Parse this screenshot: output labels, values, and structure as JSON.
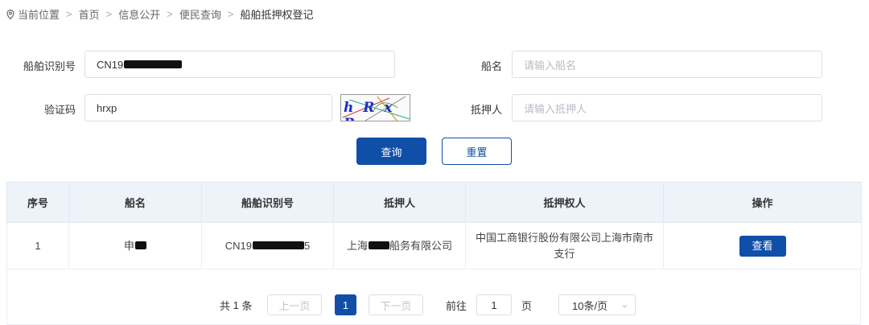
{
  "breadcrumb": {
    "items": [
      "当前位置",
      "首页",
      "信息公开",
      "便民查询",
      "船舶抵押权登记"
    ]
  },
  "form": {
    "ship_id_label": "船舶识别号",
    "ship_id_value": "CN19",
    "ship_name_label": "船名",
    "ship_name_placeholder": "请输入船名",
    "captcha_label": "验证码",
    "captcha_value": "hrxp",
    "captcha_image_text": "h R x P",
    "mortgagor_label": "抵押人",
    "mortgagor_placeholder": "请输入抵押人",
    "search_button": "查询",
    "reset_button": "重置"
  },
  "table": {
    "headers": [
      "序号",
      "船名",
      "船舶识别号",
      "抵押人",
      "抵押权人",
      "操作"
    ],
    "rows": [
      {
        "index": "1",
        "ship_name_prefix": "申",
        "ship_id_prefix": "CN19",
        "ship_id_suffix": "5",
        "mortgagor_prefix": "上海",
        "mortgagor_suffix": "船务有限公司",
        "mortgagee": "中国工商银行股份有限公司上海市南市支行",
        "action": "查看"
      }
    ]
  },
  "pagination": {
    "total_prefix": "共",
    "total": "1",
    "total_suffix": "条",
    "prev": "上一页",
    "current_page": "1",
    "next": "下一页",
    "goto_label": "前往",
    "goto_value": "1",
    "page_unit": "页",
    "page_size": "10条/页"
  },
  "colors": {
    "primary": "#0f4fa8",
    "header_bg": "#eef3fa"
  }
}
